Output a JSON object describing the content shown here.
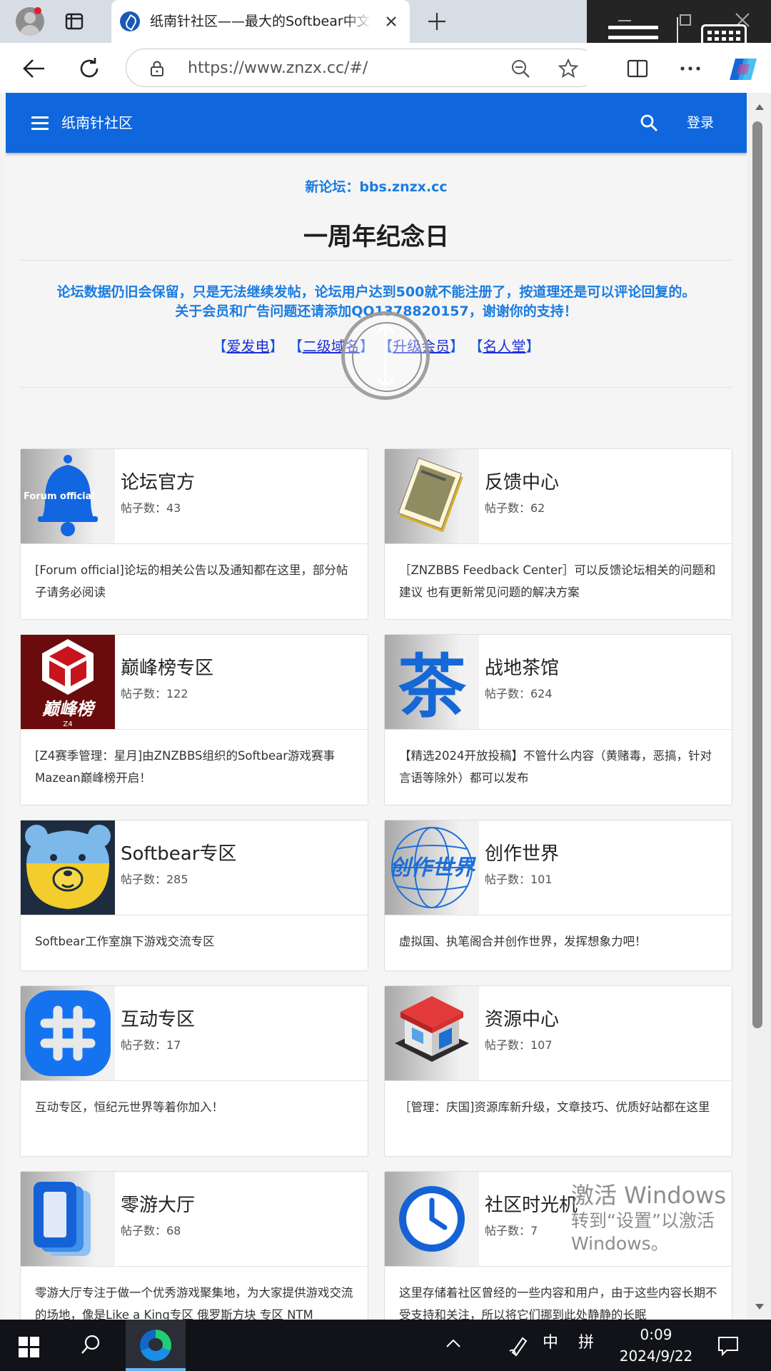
{
  "browser": {
    "tab_title": "纸南针社区——最大的Softbear中文社区",
    "url": "https://www.znzx.cc/#/"
  },
  "site": {
    "brand": "纸南针社区",
    "login_label": "登录",
    "new_forum": "新论坛：bbs.znzx.cc",
    "anniversary": "一周年纪念日",
    "notice_line1": "论坛数据仍旧会保留，只是无法继续发帖，论坛用户达到500就不能注册了，按道理还是可以评论回复的。",
    "notice_line2": "关于会员和广告问题还请添加QQ1378820157，谢谢你的支持！",
    "links": [
      {
        "label": "爱发电"
      },
      {
        "label": "二级域名"
      },
      {
        "label": "升级会员"
      },
      {
        "label": "名人堂"
      }
    ]
  },
  "boards": [
    {
      "title": "论坛官方",
      "posts": "帖子数：43",
      "icon": "bell-icon",
      "desc": "[Forum official]论坛的相关公告以及通知都在这里，部分帖子请务必阅读",
      "thumb_text": "Forum official"
    },
    {
      "title": "反馈中心",
      "posts": "帖子数：62",
      "icon": "documents-icon",
      "desc": "［ZNZBBS Feedback Center］可以反馈论坛相关的问题和建议 也有更新常见问题的解决方案"
    },
    {
      "title": "巅峰榜专区",
      "posts": "帖子数：122",
      "icon": "cube-logo-icon",
      "desc": "[Z4赛季管理：星月]由ZNZBBS组织的Softbear游戏赛事Mazean巅峰榜开启！",
      "thumb_text": "巅峰榜",
      "thumb_sub": "Z4"
    },
    {
      "title": "战地茶馆",
      "posts": "帖子数：624",
      "icon": "tea-character-icon",
      "desc": "【精选2024开放投稿】不管什么内容（黄赌毒，恶搞，针对言语等除外）都可以发布",
      "thumb_text": "茶"
    },
    {
      "title": "Softbear专区",
      "posts": "帖子数：285",
      "icon": "bear-icon",
      "desc": "Softbear工作室旗下游戏交流专区"
    },
    {
      "title": "创作世界",
      "posts": "帖子数：101",
      "icon": "globe-icon",
      "desc": "虚拟国、执笔阁合并创作世界，发挥想象力吧！",
      "thumb_text": "创作世界"
    },
    {
      "title": "互动专区",
      "posts": "帖子数：17",
      "icon": "hashtag-icon",
      "desc": "互动专区，恒纪元世界等着你加入！"
    },
    {
      "title": "资源中心",
      "posts": "帖子数：107",
      "icon": "store-icon",
      "desc": "［管理：庆国]资源库新升级，文章技巧、优质好站都在这里"
    },
    {
      "title": "零游大厅",
      "posts": "帖子数：68",
      "icon": "stacked-pages-icon",
      "desc": "零游大厅专注于做一个优秀游戏聚集地，为大家提供游戏交流的场地，像是Like a King专区 俄罗斯方块 专区 NTM"
    },
    {
      "title": "社区时光机",
      "posts": "帖子数：7",
      "icon": "clock-icon",
      "desc": "这里存储着社区曾经的一些内容和用户，由于这些内容长期不受支持和关注，所以将它们挪到此处静静的长眠"
    }
  ],
  "watermark": {
    "line1": "激活 Windows",
    "line2": "转到“设置”以激活",
    "line3": "Windows。"
  },
  "taskbar": {
    "ime1": "中",
    "ime2": "拼",
    "time": "0:09",
    "date": "2024/9/22"
  }
}
